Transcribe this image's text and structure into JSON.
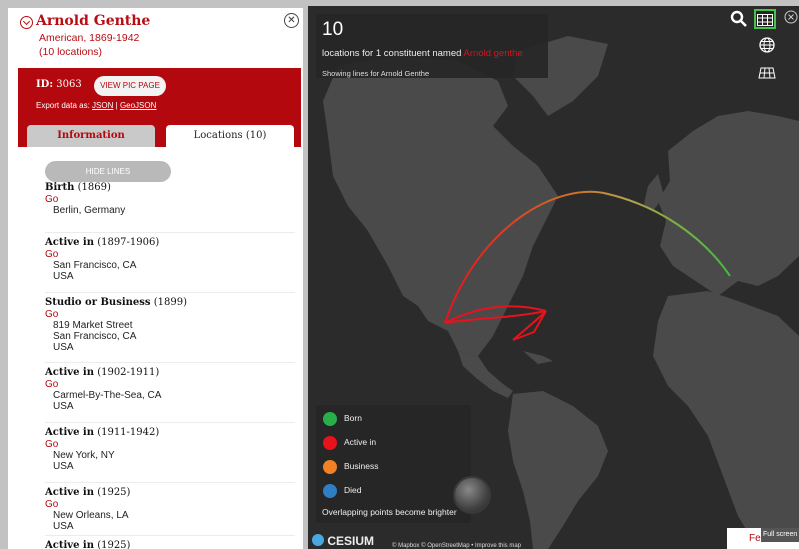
{
  "constituent": {
    "name": "Arnold Genthe",
    "nationality_dates": "American, 1869-1942",
    "locations_count": "(10 locations)"
  },
  "record": {
    "id_label": "ID:",
    "id_value": "3063",
    "view_button": "VIEW PIC PAGE",
    "export_prefix": "Export data as:",
    "export_json": "JSON",
    "export_sep": "|",
    "export_geojson": "GeoJSON"
  },
  "tabs": {
    "information": "Information",
    "locations": "Locations (10)"
  },
  "hide_lines_button": "HIDE LINES",
  "locations": [
    {
      "title": "Birth",
      "dates": "(1869)",
      "go": "Go",
      "lines": [
        "Berlin, Germany"
      ]
    },
    {
      "title": "Active in",
      "dates": "(1897-1906)",
      "go": "Go",
      "lines": [
        "San Francisco, CA",
        "USA"
      ]
    },
    {
      "title": "Studio or Business",
      "dates": "(1899)",
      "go": "Go",
      "lines": [
        "819 Market Street",
        "San Francisco, CA",
        "USA"
      ]
    },
    {
      "title": "Active in",
      "dates": "(1902-1911)",
      "go": "Go",
      "lines": [
        "Carmel-By-The-Sea, CA",
        "USA"
      ]
    },
    {
      "title": "Active in",
      "dates": "(1911-1942)",
      "go": "Go",
      "lines": [
        "New York, NY",
        "USA"
      ]
    },
    {
      "title": "Active in",
      "dates": "(1925)",
      "go": "Go",
      "lines": [
        "New Orleans, LA",
        "USA"
      ]
    },
    {
      "title": "Active in",
      "dates": "(1925)",
      "go": "",
      "lines": []
    }
  ],
  "map": {
    "count": "10",
    "desc_prefix": "locations for 1 constituent named",
    "desc_name": "Arnold genthe",
    "showing": "Showing lines for Arnold Genthe",
    "legend": [
      {
        "label": "Born",
        "color": "#27b04a"
      },
      {
        "label": "Active in",
        "color": "#e8121b"
      },
      {
        "label": "Business",
        "color": "#f28123"
      },
      {
        "label": "Died",
        "color": "#2f7ec4"
      }
    ],
    "legend_note": "Overlapping points become brighter",
    "cesium_logo": "CESIUM",
    "credits": "© Mapbox © OpenStreetMap • Improve this map",
    "feedback": "Feedback",
    "fullscreen": "Full screen",
    "accent_color": "#b3080e",
    "tool_icons": [
      "search-icon",
      "grid-icon",
      "globe-icon",
      "map-plane-icon",
      "close-icon"
    ]
  }
}
